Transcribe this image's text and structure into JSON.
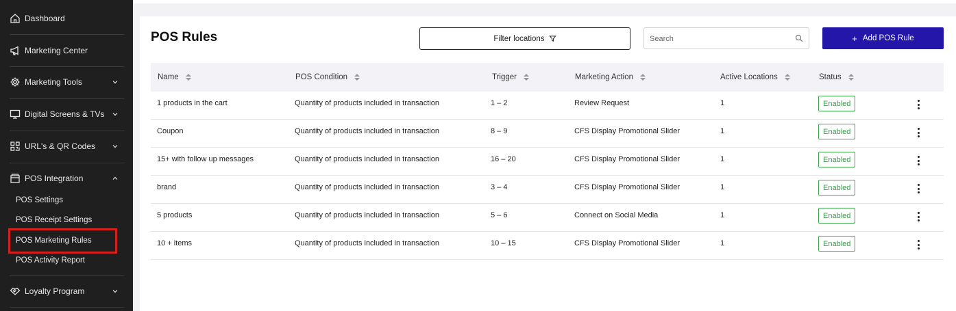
{
  "sidebar": {
    "items": [
      {
        "label": "Dashboard",
        "icon": "home-icon"
      },
      {
        "label": "Marketing Center",
        "icon": "megaphone-icon"
      },
      {
        "label": "Marketing Tools",
        "icon": "gear-icon"
      },
      {
        "label": "Digital Screens & TVs",
        "icon": "monitor-icon"
      },
      {
        "label": "URL's & QR Codes",
        "icon": "qr-code-icon"
      },
      {
        "label": "POS Integration",
        "icon": "register-icon"
      },
      {
        "label": "Loyalty Program",
        "icon": "handshake-icon"
      }
    ],
    "sub_items": [
      {
        "label": "POS Settings"
      },
      {
        "label": "POS Receipt Settings"
      },
      {
        "label": "POS Marketing Rules"
      },
      {
        "label": "POS Activity Report"
      }
    ],
    "highlight_color": "#d4201b"
  },
  "header": {
    "title": "POS Rules",
    "filter_label": "Filter locations",
    "search_placeholder": "Search",
    "add_label": "Add POS Rule",
    "add_color": "#2316a8"
  },
  "table": {
    "columns": [
      "Name",
      "POS Condition",
      "Trigger",
      "Marketing Action",
      "Active Locations",
      "Status"
    ],
    "rows": [
      {
        "name": "1 products in the cart",
        "condition": "Quantity of products included in transaction",
        "trigger": "1 – 2",
        "action": "Review Request",
        "locations": "1",
        "status": "Enabled"
      },
      {
        "name": "Coupon",
        "condition": "Quantity of products included in transaction",
        "trigger": "8 – 9",
        "action": "CFS Display Promotional Slider",
        "locations": "1",
        "status": "Enabled"
      },
      {
        "name": "15+ with follow up messages",
        "condition": "Quantity of products included in transaction",
        "trigger": "16 – 20",
        "action": "CFS Display Promotional Slider",
        "locations": "1",
        "status": "Enabled"
      },
      {
        "name": "brand",
        "condition": "Quantity of products included in transaction",
        "trigger": "3 – 4",
        "action": "CFS Display Promotional Slider",
        "locations": "1",
        "status": "Enabled"
      },
      {
        "name": "5 products",
        "condition": "Quantity of products included in transaction",
        "trigger": "5 – 6",
        "action": "Connect on Social Media",
        "locations": "1",
        "status": "Enabled"
      },
      {
        "name": "10 + items",
        "condition": "Quantity of products included in transaction",
        "trigger": "10 – 15",
        "action": "CFS Display Promotional Slider",
        "locations": "1",
        "status": "Enabled"
      }
    ],
    "status_color": "#3aa64a"
  }
}
